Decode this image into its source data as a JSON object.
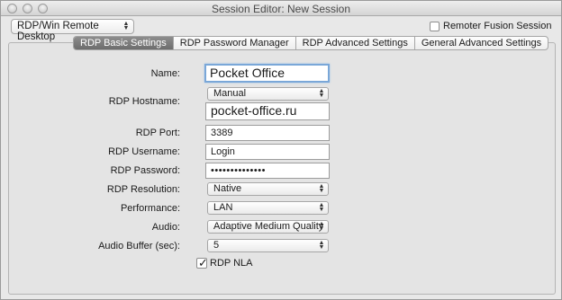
{
  "window": {
    "title": "Session Editor: New Session"
  },
  "toolbar": {
    "protocol_select": "RDP/Win Remote Desktop",
    "remoter_fusion_label": "Remoter Fusion Session",
    "remoter_fusion_checked": false
  },
  "tabs": [
    {
      "label": "RDP Basic Settings",
      "active": true
    },
    {
      "label": "RDP Password Manager",
      "active": false
    },
    {
      "label": "RDP Advanced Settings",
      "active": false
    },
    {
      "label": "General Advanced Settings",
      "active": false
    }
  ],
  "form": {
    "name": {
      "label": "Name:",
      "value": "Pocket Office"
    },
    "hostname": {
      "label": "RDP Hostname:",
      "mode": "Manual",
      "value": "pocket-office.ru"
    },
    "port": {
      "label": "RDP Port:",
      "value": "3389"
    },
    "username": {
      "label": "RDP Username:",
      "value": "Login"
    },
    "password": {
      "label": "RDP Password:",
      "value": "••••••••••••••"
    },
    "resolution": {
      "label": "RDP Resolution:",
      "value": "Native"
    },
    "performance": {
      "label": "Performance:",
      "value": "LAN"
    },
    "audio": {
      "label": "Audio:",
      "value": "Adaptive Medium Quality"
    },
    "audio_buffer": {
      "label": "Audio Buffer (sec):",
      "value": "5"
    },
    "nla": {
      "label": "RDP NLA",
      "checked": true
    }
  }
}
